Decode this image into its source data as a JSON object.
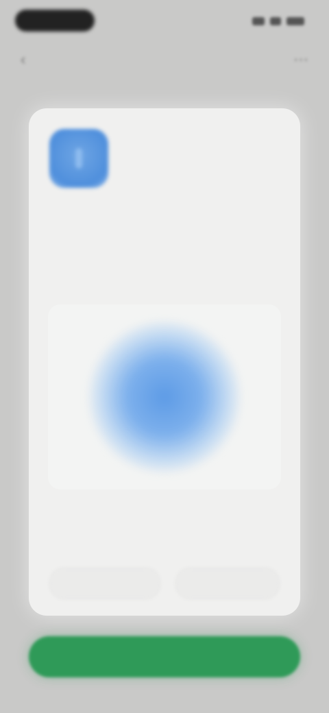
{
  "status_bar": {
    "left_pill": "",
    "indicators": [
      "signal-icon",
      "wifi-icon",
      "battery-icon"
    ]
  },
  "nav": {
    "back_icon": "chevron-left-icon",
    "more_icon": "more-icon"
  },
  "card": {
    "app_icon": "app-icon",
    "title": "",
    "description": "",
    "illustration": "blue-glow-illustration",
    "note": "",
    "left_button_label": "",
    "right_button_label": ""
  },
  "primary_button": {
    "label": "",
    "color": "#2f9a58"
  },
  "colors": {
    "background": "#c9c9c8",
    "card": "#f0f0ef",
    "accent_blue": "#5d9be6",
    "accent_green": "#2f9a58"
  }
}
